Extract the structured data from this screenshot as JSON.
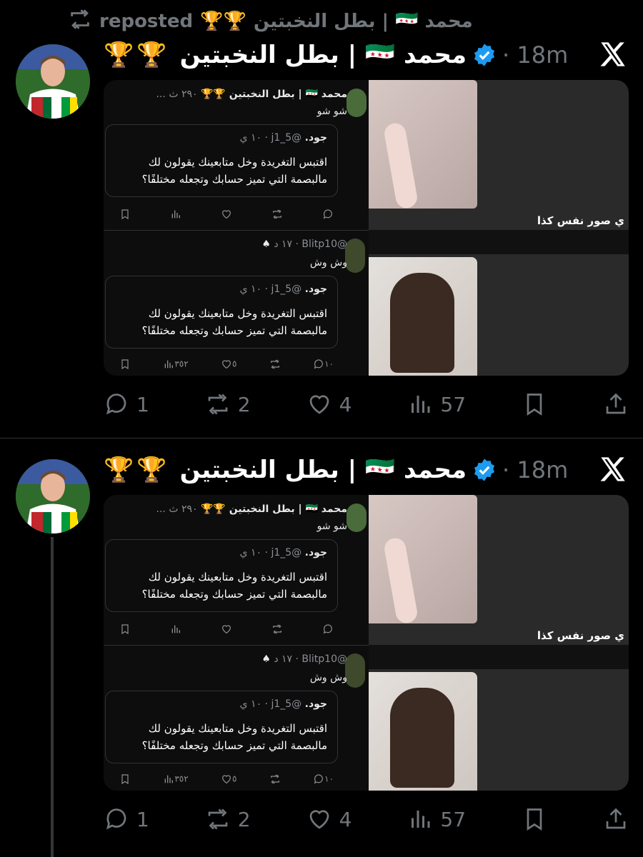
{
  "repost": {
    "icon": "repost-icon",
    "text": "reposted",
    "trophies": "🏆🏆",
    "author": "محمد 🇸🇾 | بطل النخبتين"
  },
  "colors": {
    "verified": "#1d9bf0",
    "bg": "#000000",
    "muted": "#71767b"
  },
  "posts": [
    {
      "trophies": "🏆🏆",
      "name": "محمد 🇸🇾 | بطل النخبتين",
      "time": "· 18m",
      "media": {
        "embedded_author": "محمد 🇸🇾 | بطل النخبتين 🏆🏆",
        "embedded_meta": "٢٩٠ ث ...",
        "embedded_text": "شو شو",
        "quote1": {
          "author": "جود.",
          "handle": "@5_j1",
          "time": "١٠ ي",
          "line1": "اقتبس التغريدة وخل متابعينك يقولون لك",
          "line2": "مالبصمة التي تميز حسابك وتجعله مختلفًا؟"
        },
        "reply": {
          "handle": "@Blitp10",
          "time": "١٧ د",
          "text": "وش وش"
        },
        "quote2": {
          "author": "جود.",
          "handle": "@5_j1",
          "time": "١٠ ي",
          "line1": "اقتبس التغريدة وخل متابعينك يقولون لك",
          "line2": "مالبصمة التي تميز حسابك وتجعله مختلفًا؟"
        },
        "stats2": {
          "views": "٣٥٢",
          "likes": "٥",
          "replies": "١٠"
        },
        "overlay": "ي صور نفس كذا"
      },
      "actions": {
        "replies": "1",
        "reposts": "2",
        "likes": "4",
        "views": "57"
      }
    },
    {
      "trophies": "🏆🏆",
      "name": "محمد 🇸🇾 | بطل النخبتين",
      "time": "· 18m",
      "media": {
        "embedded_author": "محمد 🇸🇾 | بطل النخبتين 🏆🏆",
        "embedded_meta": "٢٩٠ ث ...",
        "embedded_text": "شو شو",
        "quote1": {
          "author": "جود.",
          "handle": "@5_j1",
          "time": "١٠ ي",
          "line1": "اقتبس التغريدة وخل متابعينك يقولون لك",
          "line2": "مالبصمة التي تميز حسابك وتجعله مختلفًا؟"
        },
        "reply": {
          "handle": "@Blitp10",
          "time": "١٧ د",
          "text": "وش وش"
        },
        "quote2": {
          "author": "جود.",
          "handle": "@5_j1",
          "time": "١٠ ي",
          "line1": "اقتبس التغريدة وخل متابعينك يقولون لك",
          "line2": "مالبصمة التي تميز حسابك وتجعله مختلفًا؟"
        },
        "stats2": {
          "views": "٣٥٢",
          "likes": "٥",
          "replies": "١٠"
        },
        "overlay": "ي صور نفس كذا"
      },
      "actions": {
        "replies": "1",
        "reposts": "2",
        "likes": "4",
        "views": "57"
      }
    }
  ]
}
